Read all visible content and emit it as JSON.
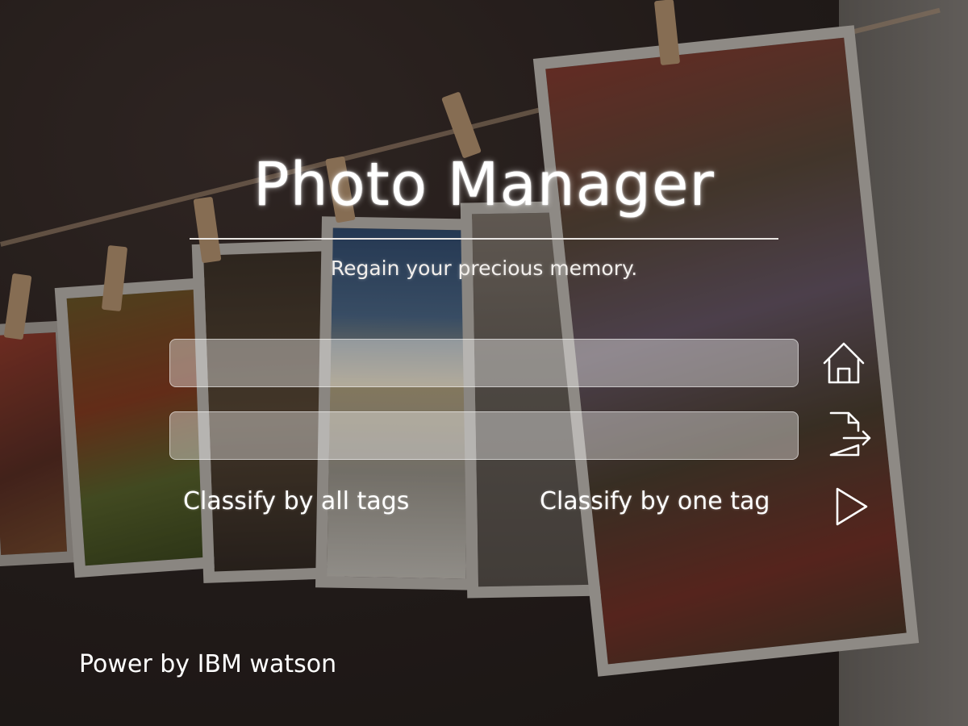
{
  "app": {
    "title": "Photo Manager",
    "subtitle": "Regain your precious memory."
  },
  "inputs": {
    "first": {
      "value": "",
      "placeholder": ""
    },
    "second": {
      "value": "",
      "placeholder": ""
    }
  },
  "icons": {
    "home": "home-icon",
    "export": "file-export-icon",
    "play": "play-icon"
  },
  "actions": {
    "classify_all": "Classify by all tags",
    "classify_one": "Classify by one tag"
  },
  "footer": {
    "text": "Power by IBM watson"
  },
  "colors": {
    "text": "#ffffff",
    "field_bg": "rgba(255,255,255,0.38)"
  }
}
